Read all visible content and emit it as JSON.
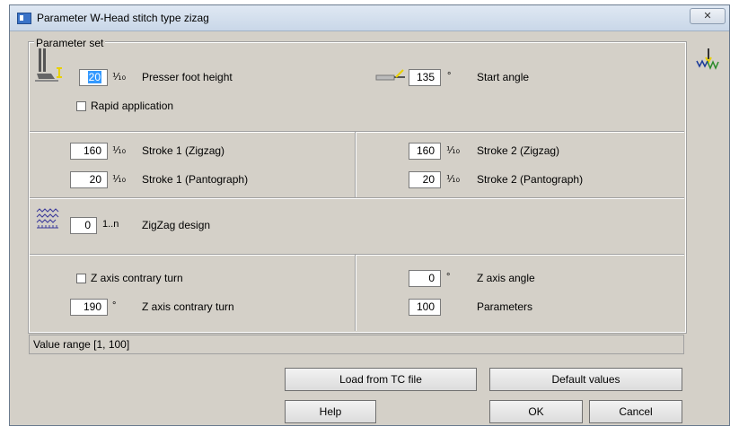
{
  "window": {
    "title": "Parameter W-Head stitch type zizag",
    "close_glyph": "✕"
  },
  "group": {
    "label": "Parameter set"
  },
  "presser": {
    "value": "20",
    "unit": "⅒",
    "label": "Presser foot height",
    "icon": "presser-foot-icon"
  },
  "start_angle": {
    "value": "135",
    "unit": "°",
    "label": "Start angle",
    "icon": "needle-angle-icon"
  },
  "rapid": {
    "label": "Rapid application",
    "checked": false
  },
  "stroke1_zigzag": {
    "value": "160",
    "unit": "⅒",
    "label": "Stroke 1 (Zigzag)"
  },
  "stroke1_panto": {
    "value": "20",
    "unit": "⅒",
    "label": "Stroke 1 (Pantograph)"
  },
  "stroke2_zigzag": {
    "value": "160",
    "unit": "⅒",
    "label": "Stroke 2 (Zigzag)"
  },
  "stroke2_panto": {
    "value": "20",
    "unit": "⅒",
    "label": "Stroke 2 (Pantograph)"
  },
  "zigzag": {
    "value": "0",
    "unit": "1..n",
    "label": "ZigZag design",
    "icon": "zigzag-pattern-icon"
  },
  "z_contrary_check": {
    "label": "Z axis contrary turn",
    "checked": false
  },
  "z_contrary": {
    "value": "190",
    "unit": "°",
    "label": "Z axis contrary turn"
  },
  "z_angle": {
    "value": "0",
    "unit": "°",
    "label": "Z axis angle"
  },
  "parameters": {
    "value": "100",
    "label": "Parameters"
  },
  "status": {
    "text": "Value range [1, 100]"
  },
  "buttons": {
    "load": "Load from TC file",
    "defaults": "Default values",
    "help": "Help",
    "ok": "OK",
    "cancel": "Cancel"
  },
  "side_icon": "w-head-icon"
}
